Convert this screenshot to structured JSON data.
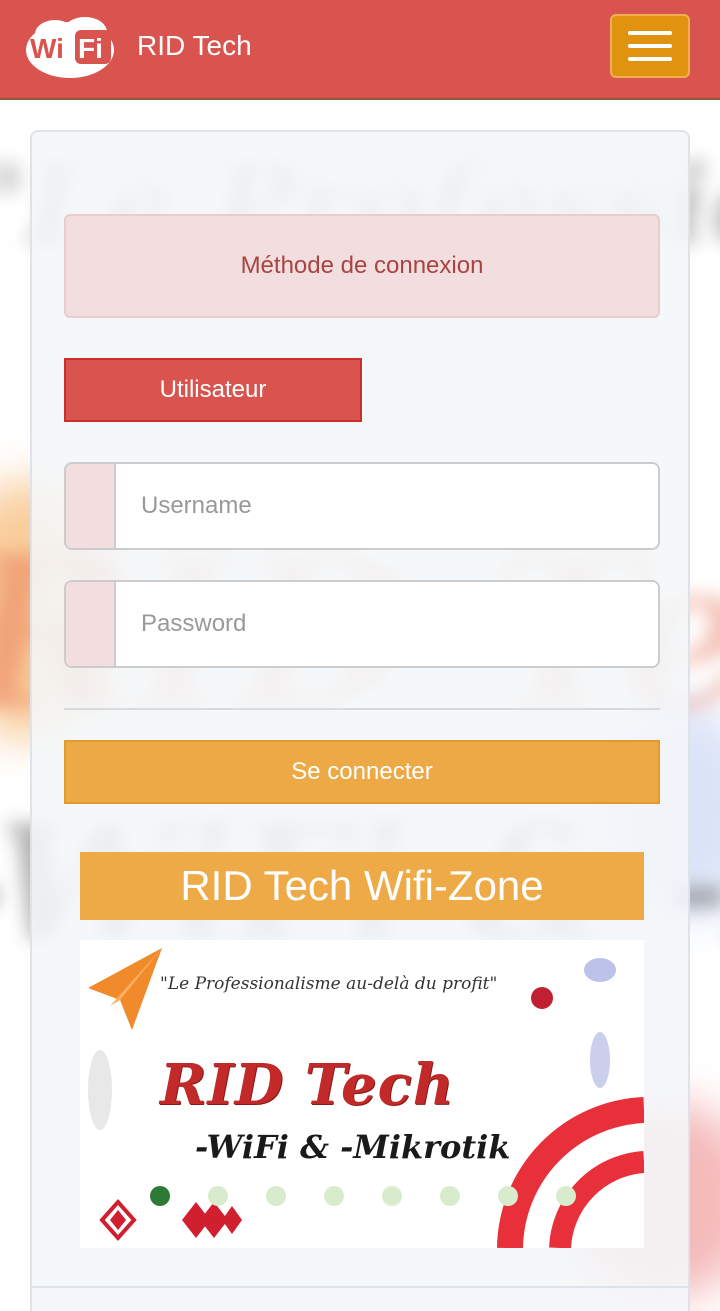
{
  "navbar": {
    "brand": "RID Tech",
    "logo_text_left": "Wi",
    "logo_text_right": "Fi",
    "menu_icon": "hamburger-menu-icon"
  },
  "login": {
    "method_label": "Méthode de connexion",
    "user_tab_label": "Utilisateur",
    "username_placeholder": "Username",
    "password_placeholder": "Password",
    "submit_label": "Se connecter"
  },
  "zone": {
    "title": "RID Tech Wifi-Zone"
  },
  "carousel": {
    "slogan": "\"Le Professionalisme au-delà du profit\"",
    "brand": "RID Tech",
    "tagline": "-WiFi & -Mikrotik",
    "slide_count": 8,
    "active_index": 0
  },
  "colors": {
    "navbar": "#d9534f",
    "toggler": "#e0930f",
    "submit": "#eea947",
    "alert_bg": "#f2dede",
    "alert_text": "#a94442",
    "active_dot": "#2d7a37"
  }
}
